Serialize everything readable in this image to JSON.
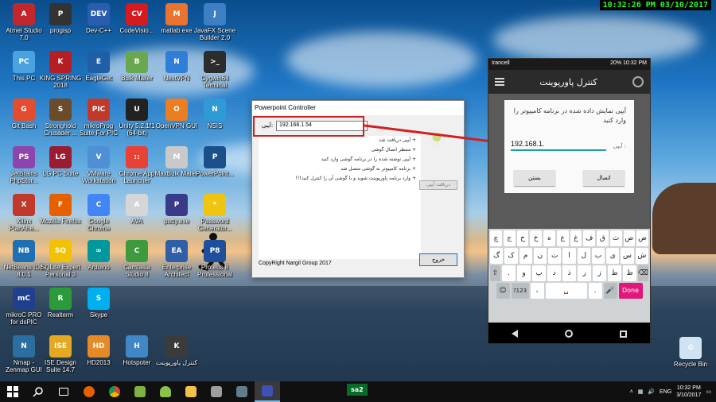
{
  "recording_clock": "10:32:26 PM 03/10/2017",
  "desktop_icons": [
    {
      "label": "Atmel Studio 7.0",
      "color": "#c1272d",
      "glyph": "A"
    },
    {
      "label": "progisp",
      "color": "#333333",
      "glyph": "P"
    },
    {
      "label": "Dev-C++",
      "color": "#2a5db0",
      "glyph": "DEV"
    },
    {
      "label": "CodeVisio...",
      "color": "#d71920",
      "glyph": "CV"
    },
    {
      "label": "matlab.exe",
      "color": "#e8742f",
      "glyph": "M"
    },
    {
      "label": "JavaFX Scene Builder 2.0",
      "color": "#3c7fc5",
      "glyph": "J"
    },
    {
      "label": "This PC",
      "color": "#4aa3df",
      "glyph": "PC"
    },
    {
      "label": "KING SPRING 2018",
      "color": "#b51f24",
      "glyph": "K"
    },
    {
      "label": "EagleGet",
      "color": "#1f5fa5",
      "glyph": "E"
    },
    {
      "label": "Bulk Mailer",
      "color": "#6aa84f",
      "glyph": "B"
    },
    {
      "label": "NextVPN",
      "color": "#2f7fd8",
      "glyph": "N"
    },
    {
      "label": "Cygwin64 Terminal",
      "color": "#2c2c2c",
      "glyph": ">_"
    },
    {
      "label": "Git Bash",
      "color": "#e44c2f",
      "glyph": "G"
    },
    {
      "label": "Stronghold Crusader ...",
      "color": "#6b4b2a",
      "glyph": "S"
    },
    {
      "label": "mikroProg Suite For PIC",
      "color": "#c0392b",
      "glyph": "PIC"
    },
    {
      "label": "Unity 5.2.1f1 (64-bit)",
      "color": "#222222",
      "glyph": "U"
    },
    {
      "label": "OpenVPN GUI",
      "color": "#ea7e20",
      "glyph": "O"
    },
    {
      "label": "NSIS",
      "color": "#2e9bd6",
      "glyph": "N"
    },
    {
      "label": "JetBrains PhpStor...",
      "color": "#8e44ad",
      "glyph": "PS"
    },
    {
      "label": "LG PC Suite",
      "color": "#9b1b30",
      "glyph": "LG"
    },
    {
      "label": "VMware Workstation",
      "color": "#4f8fd6",
      "glyph": "V"
    },
    {
      "label": "Chrome App Launcher",
      "color": "#e84135",
      "glyph": "::"
    },
    {
      "label": "MaxBulk Mailer",
      "color": "#c9c9c9",
      "glyph": "M"
    },
    {
      "label": "PowerPoint...",
      "color": "#1b4f8a",
      "glyph": "P"
    },
    {
      "label": "Xilinx PlanAhe...",
      "color": "#c0392b",
      "glyph": "X"
    },
    {
      "label": "Mozilla Firefox",
      "color": "#e66000",
      "glyph": "F"
    },
    {
      "label": "Google Chrome",
      "color": "#4285f4",
      "glyph": "C"
    },
    {
      "label": "AVA",
      "color": "#d6d6d6",
      "glyph": "A"
    },
    {
      "label": "putty.exe",
      "color": "#3a3a8a",
      "glyph": "P"
    },
    {
      "label": "Password Generator...",
      "color": "#f1c40f",
      "glyph": "*"
    },
    {
      "label": "NetBeans IDE 8.0.1",
      "color": "#1f6fb5",
      "glyph": "NB"
    },
    {
      "label": "SQLite Expert Personal 3",
      "color": "#f2c200",
      "glyph": "SQ"
    },
    {
      "label": "Arduino",
      "color": "#00979d",
      "glyph": "∞"
    },
    {
      "label": "Camtasia Studio 8",
      "color": "#3d9a3d",
      "glyph": "C"
    },
    {
      "label": "Enterprise Architect",
      "color": "#2f5fa8",
      "glyph": "EA"
    },
    {
      "label": "Proteus 8 Professional",
      "color": "#1e4f9c",
      "glyph": "P8"
    },
    {
      "label": "mikroC PRO for dsPIC",
      "color": "#1f3f8f",
      "glyph": "mC"
    },
    {
      "label": "Realterm",
      "color": "#2b9a3b",
      "glyph": "R"
    },
    {
      "label": "Skype",
      "color": "#00aff0",
      "glyph": "S"
    },
    {
      "label": "Nmap - Zenmap GUI",
      "color": "#2a6f9f",
      "glyph": "N"
    },
    {
      "label": "ISE Design Suite 14.7",
      "color": "#e5a823",
      "glyph": "ISE"
    },
    {
      "label": "HD2013",
      "color": "#e48b27",
      "glyph": "HD"
    },
    {
      "label": "Hotspoter",
      "color": "#3f88c5",
      "glyph": "H"
    },
    {
      "label": "کنترل پاورپوینت",
      "color": "#3b3b3b",
      "glyph": "K"
    },
    {
      "label": "Recycle Bin",
      "color": "#cfe3f2",
      "glyph": "♻"
    }
  ],
  "controller": {
    "title": "Powerpoint Controller",
    "ip_label": "آیپی:",
    "ip_value": "192.168.1.54",
    "messages": [
      "+ آیپی دریافت شد",
      "+ منتظر اتصال گوشی",
      "+ آیپی نوشته شده را در برنامه گوشی وارد کنید",
      "+ برنامه کامپیوتر به گوشی متصل شد",
      "+ وارد برنامه پاورپوینت شوید و با گوشی آن را کنترل کنید!!!"
    ],
    "get_ip_button": "دریافت آیپی",
    "exit_button": "خروج",
    "copyright": "CopyRight Nargil Group 2017"
  },
  "phone": {
    "status_left": "Irancell",
    "status_right": "20% 10:32 PM",
    "app_title": "کنترل پاورپوینت",
    "dialog_message": "آیپی نمایش داده شده در برنامه کامپیوتر را وارد کنید",
    "ip_label": "آیپی :",
    "ip_value": "192.168.1.",
    "connect_button": "اتصال",
    "close_button": "بستن",
    "keyboard": {
      "row1": [
        "ض",
        "ص",
        "ث",
        "ق",
        "ف",
        "غ",
        "ع",
        "ه",
        "خ",
        "ح",
        "ج",
        "چ"
      ],
      "row2": [
        "ش",
        "س",
        "ی",
        "ب",
        "ل",
        "ا",
        "ت",
        "ن",
        "م",
        "ک",
        "گ"
      ],
      "row3": [
        "ظ",
        "ط",
        "ز",
        "ر",
        "ذ",
        "د",
        "پ",
        "و",
        "."
      ],
      "num_key": "?123",
      "done_key": "Done"
    }
  },
  "taskbar": {
    "label": "sa2",
    "language": "ENG",
    "time": "10:32 PM",
    "date": "3/10/2017"
  }
}
